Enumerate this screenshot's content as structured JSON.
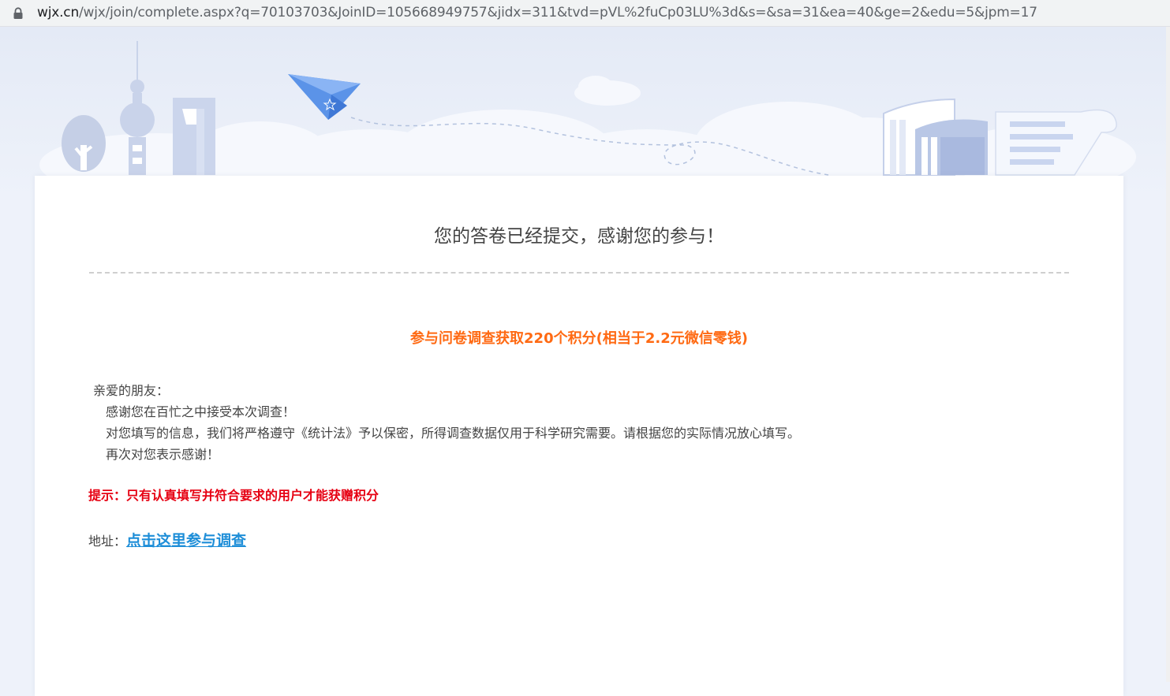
{
  "browser": {
    "url_domain": "wjx.cn",
    "url_path": "/wjx/join/complete.aspx?q=70103703&JoinID=105668949757&jidx=311&tvd=pVL%2fuCp03LU%3d&s=&sa=31&ea=40&ge=2&edu=5&jpm=17",
    "lock_icon": "lock-icon"
  },
  "main": {
    "title": "您的答卷已经提交，感谢您的参与！",
    "promo": "参与问卷调查获取220个积分(相当于2.2元微信零钱)",
    "letter": {
      "salutation": "亲爱的朋友：",
      "line1": "感谢您在百忙之中接受本次调查！",
      "line2": "对您填写的信息，我们将严格遵守《统计法》予以保密，所得调查数据仅用于科学研究需要。请根据您的实际情况放心填写。",
      "line3": "再次对您表示感谢！"
    },
    "tip": "提示：只有认真填写并符合要求的用户才能获赠积分",
    "address_label": "地址：",
    "address_link": "点击这里参与调查"
  },
  "colors": {
    "promo": "#ff6a13",
    "tip": "#e60012",
    "link": "#1e8ed8"
  }
}
